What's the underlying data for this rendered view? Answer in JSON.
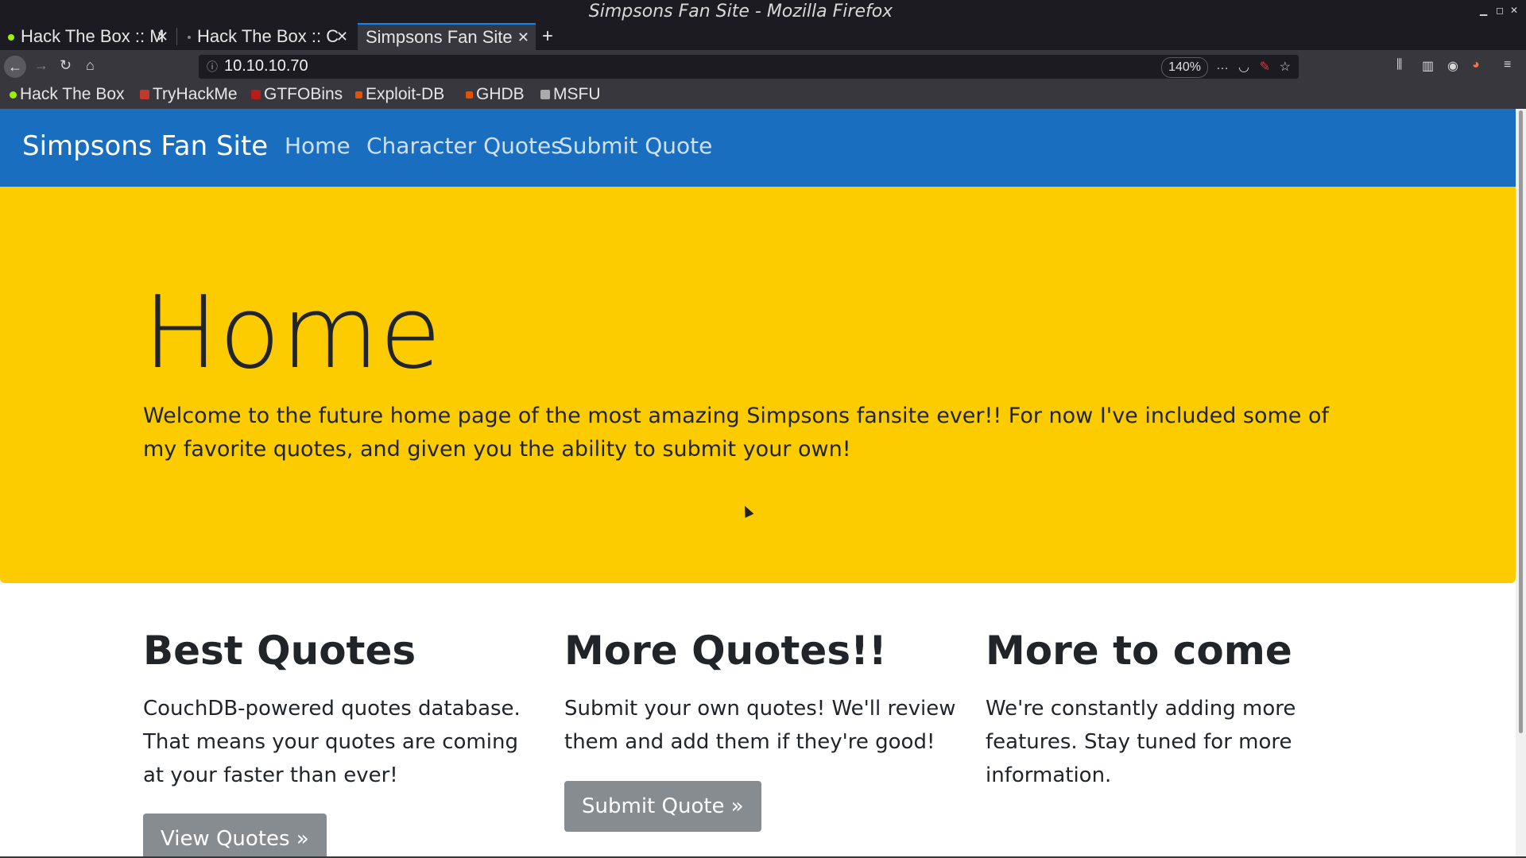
{
  "window": {
    "title": "Simpsons Fan Site - Mozilla Firefox"
  },
  "tabs": [
    {
      "label": "Hack The Box :: M",
      "favicon_color": "#9fef00"
    },
    {
      "label": "Hack The Box :: C",
      "favicon_color": "#888888"
    },
    {
      "label": "Simpsons Fan Site",
      "favicon_color": ""
    }
  ],
  "navbar": {
    "url": "10.10.10.70",
    "zoom": "140%",
    "more_icon": "…"
  },
  "bookmarks": [
    {
      "label": "Hack The Box",
      "color": "#9fef00"
    },
    {
      "label": "TryHackMe",
      "color": "#c0392b"
    },
    {
      "label": "GTFOBins",
      "color": "#b71c1c"
    },
    {
      "label": "Exploit-DB",
      "color": "#e65100"
    },
    {
      "label": "GHDB",
      "color": "#e65100"
    },
    {
      "label": "MSFU",
      "color": "#aaaaaa"
    }
  ],
  "site": {
    "brand": "Simpsons Fan Site",
    "nav": [
      "Home",
      "Character Quotes",
      "Submit Quote"
    ],
    "hero": {
      "heading": "Home",
      "text": "Welcome to the future home page of the most amazing Simpsons fansite ever!! For now I've included some of my favorite quotes, and given you the ability to submit your own!"
    },
    "columns": [
      {
        "heading": "Best Quotes",
        "text": "CouchDB-powered quotes database. That means your quotes are coming at your faster than ever!",
        "button": "View Quotes »"
      },
      {
        "heading": "More Quotes!!",
        "text": "Submit your own quotes! We'll review them and add them if they're good!",
        "button": "Submit Quote »"
      },
      {
        "heading": "More to come",
        "text": "We're constantly adding more features. Stay tuned for more information."
      }
    ]
  },
  "colors": {
    "nav_blue": "#1a6ebf",
    "hero_yellow": "#fccc00",
    "button_gray": "#878c91"
  }
}
